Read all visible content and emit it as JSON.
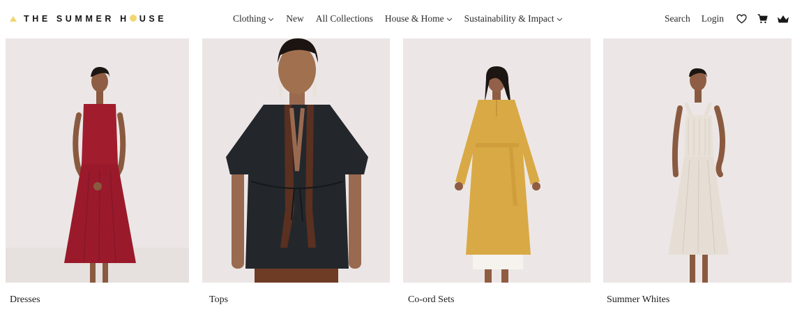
{
  "header": {
    "logo": {
      "part1": "THE SUMMER H",
      "part2": "USE"
    },
    "nav": [
      {
        "label": "Clothing",
        "dropdown": true
      },
      {
        "label": "New",
        "dropdown": false
      },
      {
        "label": "All Collections",
        "dropdown": false
      },
      {
        "label": "House & Home",
        "dropdown": true
      },
      {
        "label": "Sustainability & Impact",
        "dropdown": true
      }
    ],
    "utility": {
      "search": "Search",
      "login": "Login"
    },
    "icons": [
      "heart-icon",
      "cart-icon",
      "crown-icon"
    ]
  },
  "categories": [
    {
      "label": "Dresses",
      "garment_color": "#a11d2e"
    },
    {
      "label": "Tops",
      "garment_color": "#23272c"
    },
    {
      "label": "Co-ord Sets",
      "garment_color": "#d9a945"
    },
    {
      "label": "Summer Whites",
      "garment_color": "#e6ded5"
    }
  ],
  "colors": {
    "accent_logo": "#f1d772",
    "photo_bg": "#ece7e6",
    "text": "#1f1f1f"
  }
}
